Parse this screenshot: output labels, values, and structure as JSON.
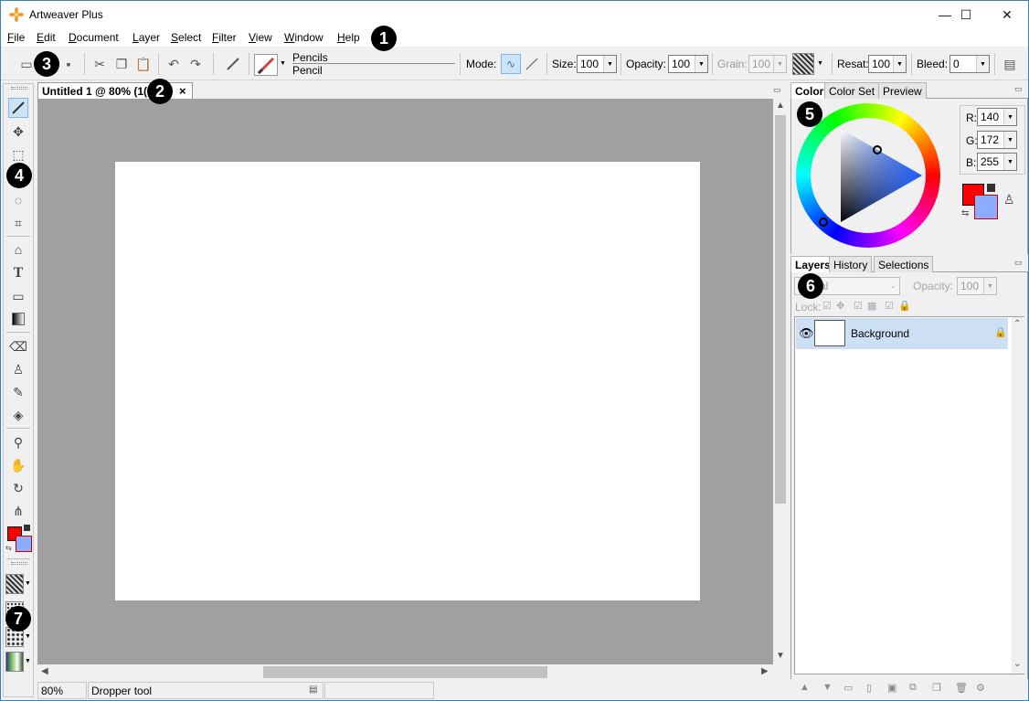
{
  "window": {
    "title": "Artweaver Plus",
    "minimize": "—",
    "maximize": "☐",
    "close": "✕"
  },
  "menu": [
    "File",
    "Edit",
    "Document",
    "Layer",
    "Select",
    "Filter",
    "View",
    "Window",
    "Help"
  ],
  "toolbar": {
    "brush_category": "Pencils",
    "brush_variant": "Pencil",
    "mode_label": "Mode:",
    "size_label": "Size:",
    "size_value": "100",
    "opacity_label": "Opacity:",
    "opacity_value": "100",
    "grain_label": "Grain:",
    "grain_value": "100",
    "resat_label": "Resat:",
    "resat_value": "100",
    "bleed_label": "Bleed:",
    "bleed_value": "0"
  },
  "document": {
    "tab_title": "Untitled 1 @ 80% (1(",
    "tab_close": "×"
  },
  "statusbar": {
    "zoom": "80%",
    "tool": "Dropper tool"
  },
  "color_panel": {
    "tabs": [
      "Color",
      "Color Set",
      "Preview"
    ],
    "r_label": "R:",
    "r_value": "140",
    "g_label": "G:",
    "g_value": "172",
    "b_label": "B:",
    "b_value": "255",
    "foreground": "#ff0000",
    "background": "#8cacff"
  },
  "layers_panel": {
    "tabs": [
      "Layers",
      "History",
      "Selections"
    ],
    "blend_mode": "al",
    "opacity_label": "Opacity:",
    "opacity_value": "100",
    "lock_label": "Lock:",
    "layers": [
      {
        "name": "Background"
      }
    ]
  },
  "callouts": [
    "1",
    "2",
    "3",
    "4",
    "5",
    "6",
    "7"
  ]
}
